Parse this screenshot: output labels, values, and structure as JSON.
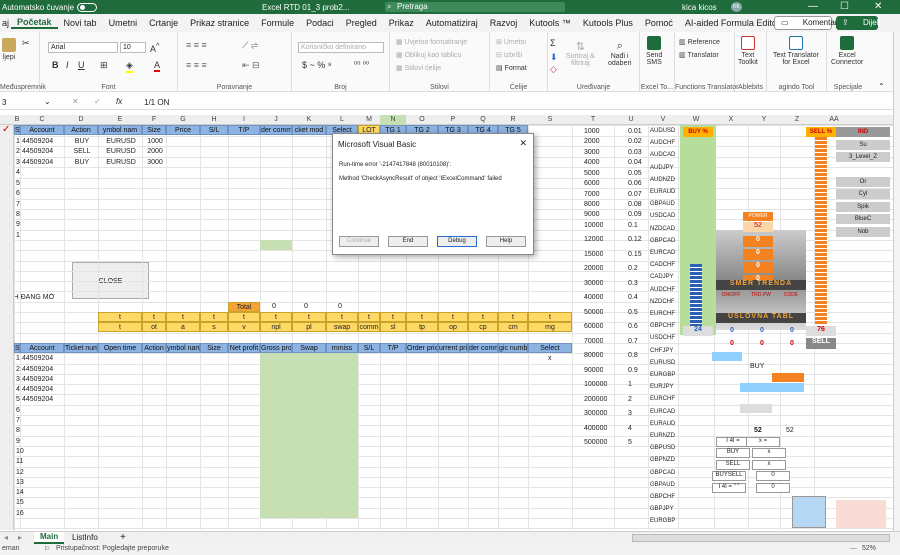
{
  "titlebar": {
    "autosave": "Automatsko čuvanje",
    "file": "Excel RTD 01_3 prob2...",
    "search": "Pretraga",
    "user": "kica kicos",
    "initials": "KK",
    "min": "—",
    "max": "☐",
    "close": "✕"
  },
  "menu": [
    "Početak",
    "Novi tab",
    "Umetni",
    "Crtanje",
    "Prikaz stranice",
    "Formule",
    "Podaci",
    "Pregled",
    "Prikaz",
    "Automatiziraj",
    "Razvoj",
    "Kutools ™",
    "Kutools Plus",
    "Pomoć",
    "AI-aided Formula Editor"
  ],
  "menu_first": "aj",
  "komentari": "Komentari",
  "dijeli": "Dijeli",
  "ribbon": {
    "clipboard": "Međuspremnik",
    "paste": "ljepi",
    "font_group": "Font",
    "font": "Arial",
    "size": "10",
    "align_group": "Poravnanje",
    "number_group": "Broj",
    "number_format": "Korisničko definirano",
    "styles_group": "Stilovi",
    "cond": "Uvjetno formatiranje",
    "table": "Oblikuj kao tablicu",
    "cellstyles": "Stilovi ćelije",
    "cells_group": "Ćelije",
    "insert": "Umetni",
    "delete": "Izbriši",
    "format": "Format",
    "editing_group": "Uređivanje",
    "sort": "Sortiraj &",
    "sort2": "filtriraj",
    "find": "Nađi i",
    "find2": "odaberi",
    "sms": "Send",
    "sms2": "SMS",
    "excel_to": "Excel To...",
    "ft_group": "Functions Translator",
    "reference": "Reference",
    "translator": "Translator",
    "textbtn": "Text",
    "textbtn2": "Toolkit",
    "ablebits": "Ablebits",
    "tt": "Text Translator",
    "tt2": "for Excel",
    "tt_group": "agindo Tool",
    "excon": "Excel",
    "excon2": "Connector",
    "spec": "Specijale"
  },
  "formula": {
    "namebox": "3",
    "fx": "fx",
    "content": "1/1  ON"
  },
  "columns": [
    "B",
    "C",
    "D",
    "E",
    "F",
    "G",
    "H",
    "I",
    "J",
    "K",
    "L",
    "M",
    "N",
    "O",
    "P",
    "Q",
    "R",
    "S",
    "T",
    "U",
    "V",
    "W",
    "X",
    "Y",
    "Z",
    "AA"
  ],
  "rows1": {
    "headers": [
      "STT",
      "Account",
      "Action",
      "ymbol nam",
      "Size",
      "Price",
      "S/L",
      "T/P",
      "der comme",
      "cket mod",
      "Select",
      "LOT",
      "TG 1",
      "TG 2",
      "TG 3",
      "TG 4",
      "TG 5"
    ],
    "data": [
      [
        "1",
        "44509204",
        "BUY",
        "EURUSD",
        "1000"
      ],
      [
        "2",
        "44509204",
        "SELL",
        "EURUSD",
        "2000"
      ],
      [
        "3",
        "44509204",
        "BUY",
        "EURUSD",
        "3000"
      ],
      [
        "4"
      ],
      [
        "5"
      ],
      [
        "6"
      ],
      [
        "7"
      ],
      [
        "8"
      ],
      [
        "9"
      ],
      [
        "10"
      ]
    ]
  },
  "close_button": "CLOSE",
  "lenh": "LỆNH ĐANG MỞ",
  "total": {
    "label": "Total",
    "v1": "0",
    "v2": "0",
    "v3": "0"
  },
  "trow1": [
    "t",
    "t",
    "t",
    "t",
    "t",
    "t",
    "t",
    "t",
    "t",
    "t",
    "t",
    "t",
    "t",
    "t",
    "t"
  ],
  "trow2": [
    "t",
    "ot",
    "a",
    "s",
    "v",
    "npl",
    "pl",
    "swap",
    "comm",
    "sl",
    "tp",
    "op",
    "cp",
    "cm",
    "mg"
  ],
  "rows2": {
    "headers": [
      "STT",
      "Account",
      "Ticket number",
      "Open time",
      "Action",
      "ymbol nam",
      "Size",
      "Net profit",
      "Gross prof",
      "Swap",
      "mmiss",
      "S/L",
      "T/P",
      "Order price",
      "urrent pric",
      "der comm",
      "gic numb",
      "Select"
    ],
    "data": [
      [
        "1",
        "44509204"
      ],
      [
        "2",
        "44509204"
      ],
      [
        "3",
        "44509204"
      ],
      [
        "4",
        "44509204"
      ],
      [
        "5",
        "44509204"
      ],
      [
        "6"
      ],
      [
        "7"
      ],
      [
        "8"
      ],
      [
        "9"
      ],
      [
        "10"
      ],
      [
        "11"
      ],
      [
        "12"
      ],
      [
        "13"
      ],
      [
        "14"
      ],
      [
        "15"
      ],
      [
        "16"
      ]
    ],
    "select_x": "x"
  },
  "tcol": [
    "1000",
    "2000",
    "3000",
    "4000",
    "5000",
    "6000",
    "7000",
    "8000",
    "9000",
    "10000",
    "12000",
    "15000",
    "20000",
    "30000",
    "40000",
    "50000",
    "60000",
    "70000",
    "80000",
    "90000",
    "100000",
    "200000",
    "300000",
    "400000",
    "500000"
  ],
  "ucol": [
    "0.01",
    "0.02",
    "0.03",
    "0.04",
    "0.05",
    "0.06",
    "0.07",
    "0.08",
    "0.09",
    "0.1",
    "0.12",
    "0.15",
    "0.2",
    "0.3",
    "0.4",
    "0.5",
    "0.6",
    "0.7",
    "0.8",
    "0.9",
    "1",
    "2",
    "3",
    "4",
    "5"
  ],
  "vcol": [
    "AUDUSD",
    "AUDCHF",
    "AUDCAD",
    "AUDJPY",
    "AUDNZD",
    "EURAUD",
    "GBPAUD",
    "USDCAD",
    "NZDCAD",
    "GBPCAD",
    "EURCAD",
    "CADCHF",
    "CADJPY",
    "AUDCHF",
    "NZDCHF",
    "EURCHF",
    "GBPCHF",
    "USDCHF",
    "CHFJPY",
    "EURUSD",
    "EURGBP",
    "EURJPY",
    "EURCHF",
    "EURCAD",
    "EURAUD",
    "EURNZD",
    "GBPUSD",
    "GBPNZD",
    "GBPCAD",
    "GBPAUD",
    "GBPCHF",
    "GBPJPY",
    "EURGBP"
  ],
  "panel": {
    "buy": "BUY %",
    "sell": "SELL %",
    "power": "POWER",
    "power_val": "52",
    "zeros": [
      "0",
      "0",
      "0",
      "0"
    ],
    "smer": "SMER TRENDA",
    "onoff": "ON/OFF",
    "trdpw": "TRD.PW",
    "code": "CODE",
    "uslovna": "USLOVNA TABL",
    "v24": "24",
    "v76": "76",
    "sellbtn": "SELL",
    "buy_label": "BUY",
    "val52": "52",
    "val52b": "52",
    "eq1": "I 4I =",
    "eq2": "x =",
    "buy2": "BUY",
    "x1": "x",
    "sell2": "SELL",
    "x2": "x",
    "buysell": "BUYSELL",
    "z1": "0",
    "eq3": "I 4I = \" \"",
    "z2": "0",
    "zrow1": [
      "0",
      "0",
      "0"
    ],
    "zrow2": [
      "0",
      "0",
      "0"
    ]
  },
  "right_panel": [
    "IND",
    "Su",
    "3_Level_Z",
    "Or",
    "Cyl",
    "Spik",
    "BlueC",
    "Nob"
  ],
  "dialog": {
    "title": "Microsoft Visual Basic",
    "line1": "Run-time error '-2147417848 (80010108)':",
    "line2": "Method 'CheckAsyncResult' of object 'IExcelCommand' failed",
    "continue": "Continue",
    "end": "End",
    "debug": "Debug",
    "help": "Help",
    "close": "✕"
  },
  "tabs": {
    "main": "Main",
    "listinfo": "ListInfo",
    "add": "+"
  },
  "status": {
    "mode": "eman",
    "acc": "Pristupačnost: Pogledajte preporuke",
    "zoom": "52%"
  }
}
